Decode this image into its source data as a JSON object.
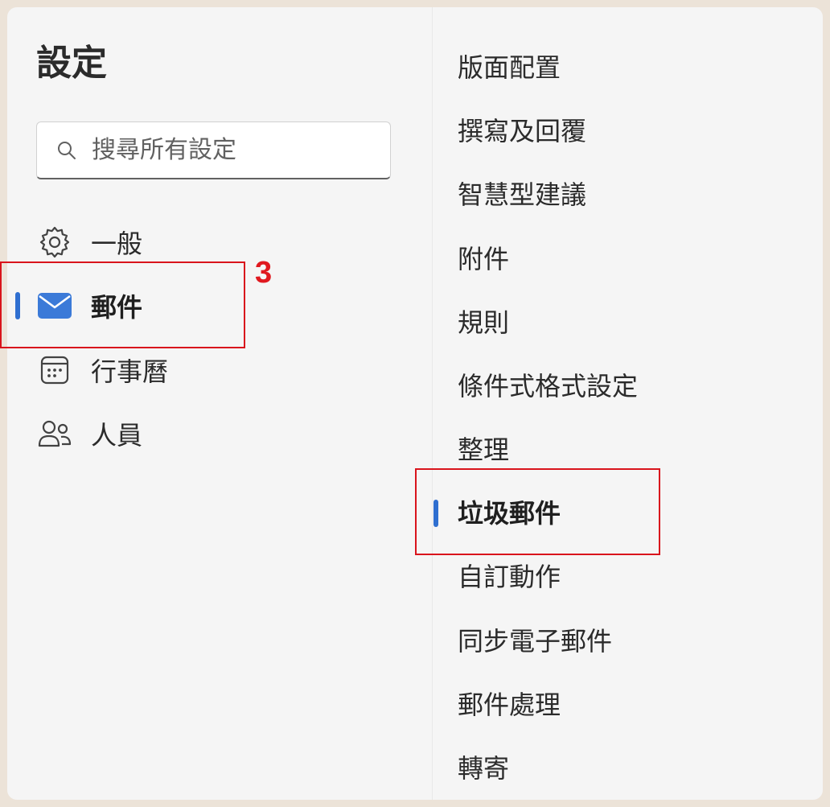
{
  "settings": {
    "title": "設定",
    "search": {
      "placeholder": "搜尋所有設定",
      "value": ""
    },
    "nav": [
      {
        "label": "一般",
        "icon": "gear-icon",
        "active": false
      },
      {
        "label": "郵件",
        "icon": "mail-icon",
        "active": true
      },
      {
        "label": "行事曆",
        "icon": "calendar-icon",
        "active": false
      },
      {
        "label": "人員",
        "icon": "people-icon",
        "active": false
      }
    ],
    "mail_sections": [
      "版面配置",
      "撰寫及回覆",
      "智慧型建議",
      "附件",
      "規則",
      "條件式格式設定",
      "整理",
      "垃圾郵件",
      "自訂動作",
      "同步電子郵件",
      "郵件處理",
      "轉寄"
    ],
    "active_section": "垃圾郵件"
  },
  "annotation": {
    "step_number": "3"
  },
  "colors": {
    "accent": "#2f6fd0",
    "highlight": "#d9141c"
  }
}
